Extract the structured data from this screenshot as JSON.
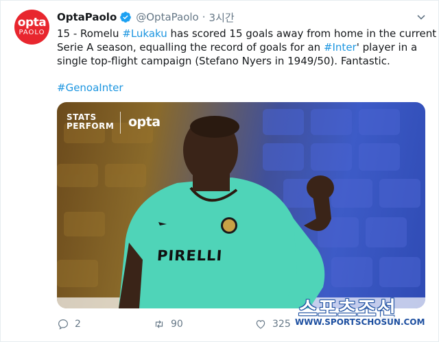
{
  "account": {
    "avatar_line1": "opta",
    "avatar_line2": "PAOLO",
    "display_name": "OptaPaolo",
    "handle": "@OptaPaolo",
    "separator": "·",
    "time": "3시간"
  },
  "tweet": {
    "line1_pre": "15 - Romelu ",
    "line1_tag": "#Lukaku",
    "line1_post": " has scored 15 goals away from home in the current",
    "line2_pre": "Serie A season, equalling the record of goals for an ",
    "line2_tag": "#Inter",
    "line2_post": "' player in a",
    "line3": "single top-flight campaign (Stefano Nyers in 1949/50). Fantastic.",
    "hashtag": "#GenoaInter"
  },
  "media": {
    "stats_line1": "STATS",
    "stats_line2": "PERFORM",
    "opta_logo": "opta",
    "shirt_sponsor": "PIRELLI"
  },
  "actions": {
    "replies": "2",
    "retweets": "90",
    "likes": "325"
  },
  "watermark": {
    "main": "스포츠조선",
    "url": "WWW.SPORTSCHOSUN.COM"
  },
  "colors": {
    "link": "#1b95e0",
    "muted": "#657786",
    "avatar_bg": "#e8262e",
    "verified": "#1da1f2",
    "shirt": "#4fd4b8"
  },
  "icons": [
    "verified-badge-icon",
    "caret-down-icon",
    "reply-icon",
    "retweet-icon",
    "like-icon"
  ]
}
